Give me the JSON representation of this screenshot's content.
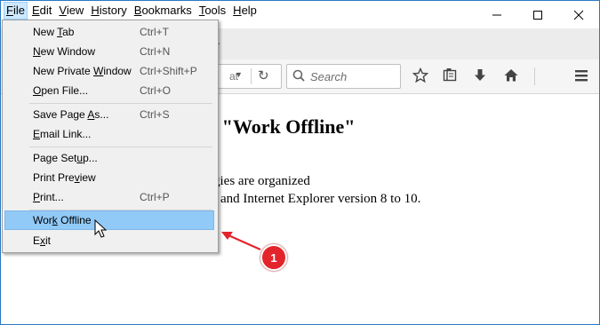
{
  "menubar": {
    "items": [
      {
        "label": "File",
        "key": "F",
        "rest": "ile"
      },
      {
        "label": "Edit",
        "key": "E",
        "rest": "dit"
      },
      {
        "label": "View",
        "key": "V",
        "rest": "iew"
      },
      {
        "label": "History",
        "key": "H",
        "rest": "istory"
      },
      {
        "label": "Bookmarks",
        "key": "B",
        "rest": "ookmarks"
      },
      {
        "label": "Tools",
        "key": "T",
        "rest": "ools"
      },
      {
        "label": "Help",
        "key": "H",
        "rest": "elp"
      }
    ]
  },
  "tabstrip": {
    "new_tab_glyph": "+"
  },
  "navbar": {
    "url_visible": "at",
    "search_placeholder": "Search"
  },
  "content": {
    "heading_visible": "k \"Work Offline\"",
    "line1_visible": "gies are organized",
    "line2_visible": "and Internet Explorer version 8 to 10."
  },
  "file_menu": {
    "items": [
      {
        "pre": "New ",
        "key": "T",
        "post": "ab",
        "shortcut": "Ctrl+T"
      },
      {
        "pre": "",
        "key": "N",
        "post": "ew Window",
        "shortcut": "Ctrl+N"
      },
      {
        "pre": "New Private ",
        "key": "W",
        "post": "indow",
        "shortcut": "Ctrl+Shift+P"
      },
      {
        "pre": "",
        "key": "O",
        "post": "pen File...",
        "shortcut": "Ctrl+O"
      },
      {
        "pre": "Save Page ",
        "key": "A",
        "post": "s...",
        "shortcut": "Ctrl+S"
      },
      {
        "pre": "",
        "key": "E",
        "post": "mail Link...",
        "shortcut": ""
      },
      {
        "pre": "Page Set",
        "key": "u",
        "post": "p...",
        "shortcut": ""
      },
      {
        "pre": "Print Pre",
        "key": "v",
        "post": "iew",
        "shortcut": ""
      },
      {
        "pre": "",
        "key": "P",
        "post": "rint...",
        "shortcut": "Ctrl+P"
      },
      {
        "pre": "Wor",
        "key": "k",
        "post": " Offline",
        "shortcut": ""
      },
      {
        "pre": "E",
        "key": "x",
        "post": "it",
        "shortcut": ""
      }
    ]
  },
  "annotation": {
    "step": "1",
    "color": "#e3242b"
  },
  "colors": {
    "window_border": "#2b79c2",
    "menu_highlight": "#91c9f7"
  }
}
